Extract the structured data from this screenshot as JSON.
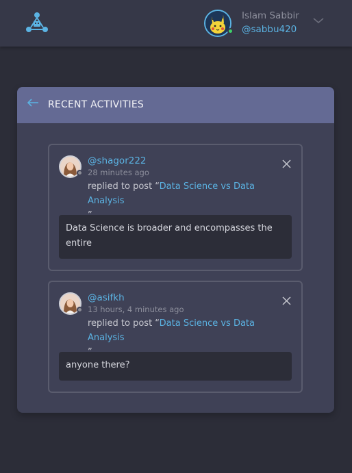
{
  "header": {
    "logo_icon": "network-logo-icon",
    "user": {
      "name": "Islam Sabbir",
      "handle": "@sabbu420",
      "avatar_icon": "pikachu-avatar",
      "online": true
    },
    "menu_icon": "chevron-down-icon"
  },
  "panel": {
    "title": "RECENT ACTIVITIES",
    "back_icon": "arrow-left-icon"
  },
  "activities": [
    {
      "handle": "@shagor222",
      "time": "28 minutes ago",
      "action_prefix": "replied to post “",
      "post_title": "Data Science vs Data Analysis",
      "action_suffix": "”",
      "reply": "Data Science is broader and encompasses the entire",
      "status": "offline"
    },
    {
      "handle": "@asifkh",
      "time": "13 hours, 4 minutes ago",
      "action_prefix": "replied to post “",
      "post_title": "Data Science vs Data Analysis",
      "action_suffix": "”",
      "reply": "anyone there?",
      "status": "offline"
    }
  ],
  "colors": {
    "background": "#2c2d38",
    "topbar": "#363848",
    "panel": "#3f4156",
    "panel_header": "#646a94",
    "accent": "#5bb3e3",
    "online": "#3ecf6a"
  }
}
